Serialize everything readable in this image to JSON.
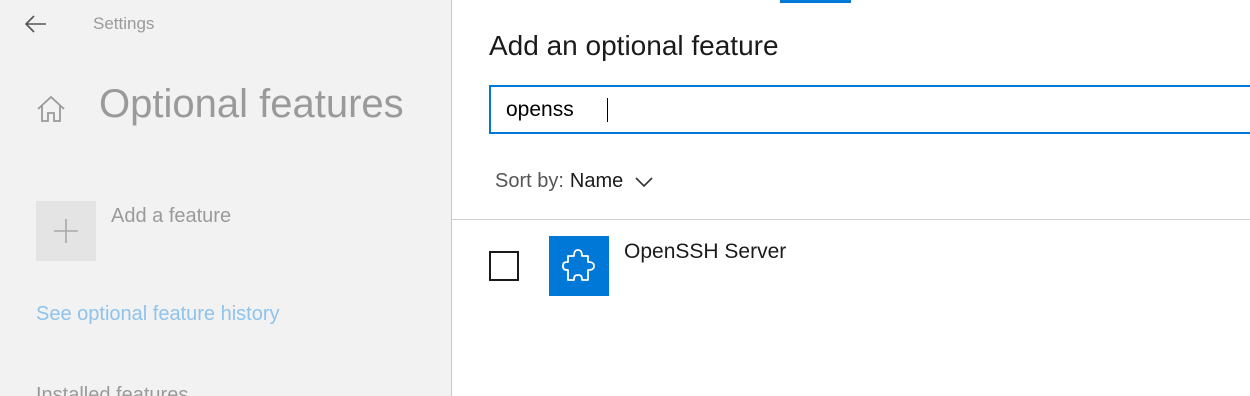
{
  "window": {
    "title": "Settings",
    "back_icon": "back-arrow-icon"
  },
  "settings": {
    "page_title": "Optional features",
    "home_icon": "home-icon",
    "add_feature_label": "Add a feature",
    "add_feature_icon": "plus-icon",
    "history_link": "See optional feature history",
    "installed_heading_partial": "Installed features"
  },
  "dialog": {
    "title": "Add an optional feature",
    "search": {
      "value": "openss",
      "placeholder": ""
    },
    "sort": {
      "label": "Sort by:",
      "value": "Name",
      "icon": "chevron-down-icon"
    },
    "features": [
      {
        "name": "OpenSSH Server",
        "checked": false,
        "icon": "puzzle-piece-icon"
      }
    ]
  },
  "colors": {
    "accent": "#0078d7",
    "link": "#8fc3ec",
    "dimmed_text": "#9a9a9a",
    "settings_bg": "#f2f2f2"
  }
}
